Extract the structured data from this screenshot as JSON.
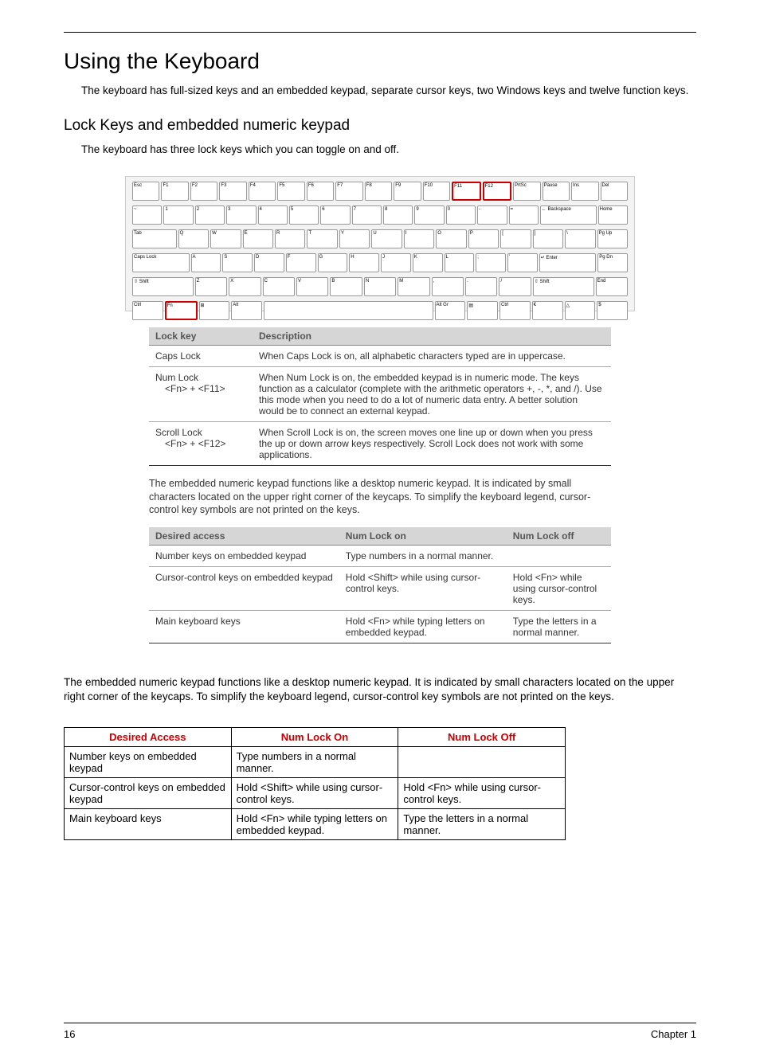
{
  "title": "Using the Keyboard",
  "intro": "The keyboard has full-sized keys and an embedded keypad, separate cursor keys, two Windows keys and twelve function keys.",
  "subhead": "Lock Keys and embedded numeric keypad",
  "subhead_intro": "The keyboard has three lock keys which you can toggle on and off.",
  "lock_table": {
    "h1": "Lock key",
    "h2": "Description",
    "rows": [
      {
        "k": "Caps Lock",
        "k2": "",
        "d": "When Caps Lock is on, all alphabetic characters typed are in uppercase."
      },
      {
        "k": "Num Lock",
        "k2": "<Fn> + <F11>",
        "d": "When Num Lock is on, the embedded keypad is in numeric mode. The keys function as a calculator (complete with the arithmetic operators +, -, *, and /). Use this mode when you need to do a lot of numeric data entry. A better solution would be to connect an external keypad."
      },
      {
        "k": "Scroll Lock",
        "k2": "<Fn> + <F12>",
        "d": "When Scroll Lock is on, the screen moves one line up or down when you press the up or down arrow keys respectively. Scroll Lock does not work with some applications."
      }
    ]
  },
  "inner_para": "The embedded numeric keypad functions like a desktop numeric keypad. It is indicated by small characters located on the upper right corner of the keycaps. To simplify the keyboard legend, cursor-control key symbols are not printed on the keys.",
  "numlock_table": {
    "h1": "Desired access",
    "h2": "Num Lock on",
    "h3": "Num Lock off",
    "rows": [
      {
        "a": "Number keys on embedded keypad",
        "b": "Type numbers in a normal manner.",
        "c": ""
      },
      {
        "a": "Cursor-control keys on embedded keypad",
        "b": "Hold <Shift> while using cursor-control keys.",
        "c": "Hold <Fn> while using cursor-control keys."
      },
      {
        "a": "Main keyboard keys",
        "b": "Hold <Fn> while typing letters on embedded keypad.",
        "c": "Type the letters in a normal manner."
      }
    ]
  },
  "lower_para": "The embedded numeric keypad functions like a desktop numeric keypad. It is indicated by small characters located on the upper right corner of the keycaps. To simplify the keyboard legend, cursor-control key symbols are not printed on the keys.",
  "access_table": {
    "h1": "Desired Access",
    "h2": "Num Lock On",
    "h3": "Num Lock Off",
    "rows": [
      {
        "a": "Number keys on embedded keypad",
        "b": "Type numbers in a normal manner.",
        "c": ""
      },
      {
        "a": "Cursor-control keys on embedded keypad",
        "b": "Hold <Shift> while using cursor-control keys.",
        "c": "Hold <Fn> while using cursor-control keys."
      },
      {
        "a": "Main keyboard keys",
        "b": "Hold <Fn> while typing letters on embedded keypad.",
        "c": "Type the letters in a normal manner."
      }
    ]
  },
  "footer": {
    "left": "16",
    "right": "Chapter 1"
  }
}
